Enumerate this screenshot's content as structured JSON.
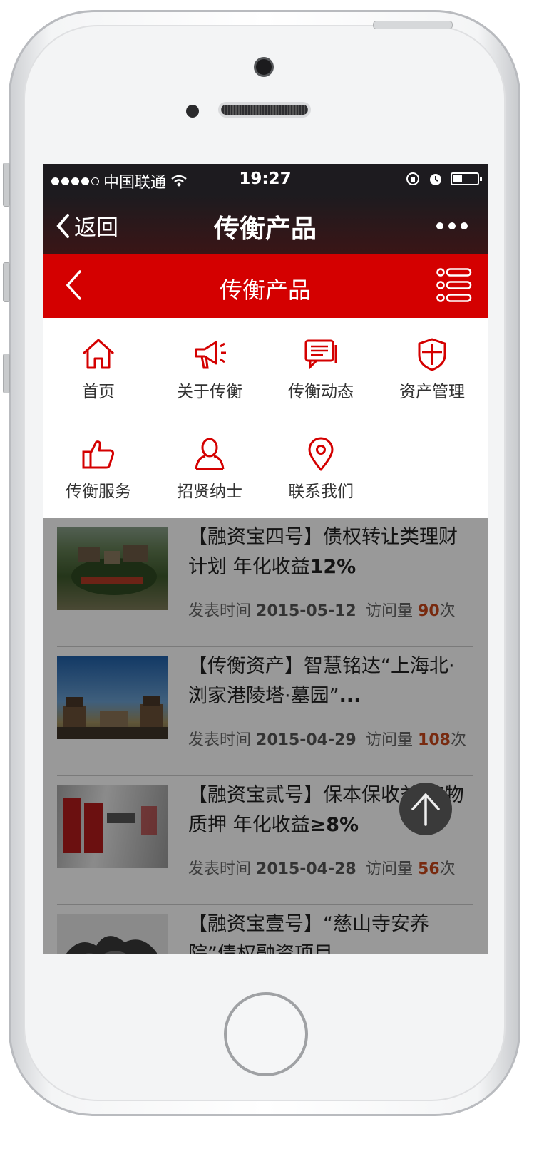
{
  "status_bar": {
    "carrier": "中国联通",
    "time": "19:27"
  },
  "wechat_nav": {
    "back_label": "返回",
    "title": "传衡产品"
  },
  "site_header": {
    "title": "传衡产品"
  },
  "menu": [
    {
      "label": "首页",
      "icon": "home-icon"
    },
    {
      "label": "关于传衡",
      "icon": "megaphone-icon"
    },
    {
      "label": "传衡动态",
      "icon": "chat-icon"
    },
    {
      "label": "资产管理",
      "icon": "shield-icon"
    },
    {
      "label": "传衡服务",
      "icon": "thumbs-up-icon"
    },
    {
      "label": "招贤纳士",
      "icon": "person-icon"
    },
    {
      "label": "联系我们",
      "icon": "location-pin-icon"
    }
  ],
  "articles": [
    {
      "title_a": "【融资宝四号】债权转让类理财计划 年化收益",
      "title_b": "12%",
      "date_label": "发表时间",
      "date": "2015-05-12",
      "visits_label": "访问量",
      "visits": "90",
      "visits_unit": "次"
    },
    {
      "title_a": "【传衡资产】智慧铭达“上海北·浏家港陵塔·墓园”",
      "title_b": "...",
      "date_label": "发表时间",
      "date": "2015-04-29",
      "visits_label": "访问量",
      "visits": "108",
      "visits_unit": "次"
    },
    {
      "title_a": "【融资宝贰号】保本保收益·实物质押 年化收益",
      "title_b": "≥8%",
      "date_label": "发表时间",
      "date": "2015-04-28",
      "visits_label": "访问量",
      "visits": "56",
      "visits_unit": "次"
    },
    {
      "title_a": "【融资宝壹号】“慈山寺安养院”债权融资项目",
      "title_b": "",
      "date_label": "",
      "date": "",
      "visits_label": "",
      "visits": "",
      "visits_unit": ""
    }
  ],
  "colors": {
    "brand_red": "#d40000",
    "accent_count": "#c9461a"
  }
}
